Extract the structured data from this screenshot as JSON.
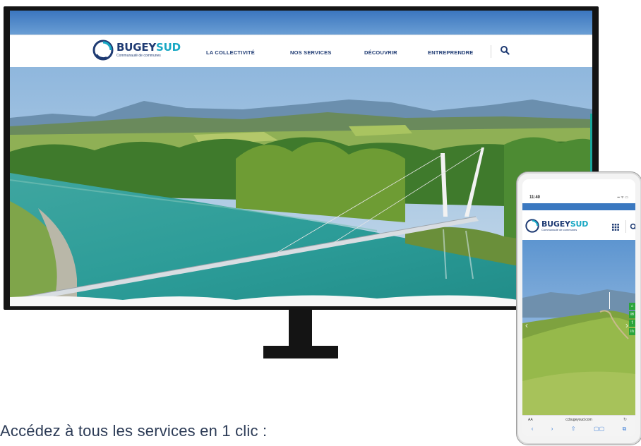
{
  "desktop": {
    "logo": {
      "name_part1": "BUGEY",
      "name_part2": "SUD",
      "subtitle": "Communauté de communes"
    },
    "nav": [
      {
        "label": "LA COLLECTIVITÉ"
      },
      {
        "label": "NOS SERVICES"
      },
      {
        "label": "DÉCOUVRIR"
      },
      {
        "label": "ENTREPRENDRE"
      }
    ],
    "icons": {
      "search": "search-icon",
      "logo": "bugeysud-logo-icon"
    },
    "hero": {
      "subject": "hero-image-footbridge-over-rhone"
    }
  },
  "mobile": {
    "status": {
      "time": "11:40",
      "indicators": "▪▪ ᯤ ▭"
    },
    "logo": {
      "name_part1": "BUGEY",
      "name_part2": "SUD",
      "subtitle": "Communauté de communes"
    },
    "icons": {
      "menu": "grid-menu-icon",
      "search": "search-icon"
    },
    "social": [
      "home-icon",
      "mail-icon",
      "facebook-icon",
      "linkedin-icon"
    ],
    "social_glyphs": [
      "⌂",
      "✉",
      "f",
      "in"
    ],
    "carousel": {
      "prev": "‹",
      "next": "›"
    },
    "browser": {
      "text_size": "AA",
      "url": "ccbugeysud.com",
      "reload": "↻",
      "toolbar": [
        "‹",
        "›",
        "⇧",
        "▢▢",
        "⧉"
      ]
    }
  },
  "caption": "Accédez à tous les services en 1 clic :",
  "colors": {
    "brand_navy": "#1f3b73",
    "brand_cyan": "#19a8c4",
    "accent_green": "#2aa53b",
    "accent_teal": "#1aa79c"
  }
}
